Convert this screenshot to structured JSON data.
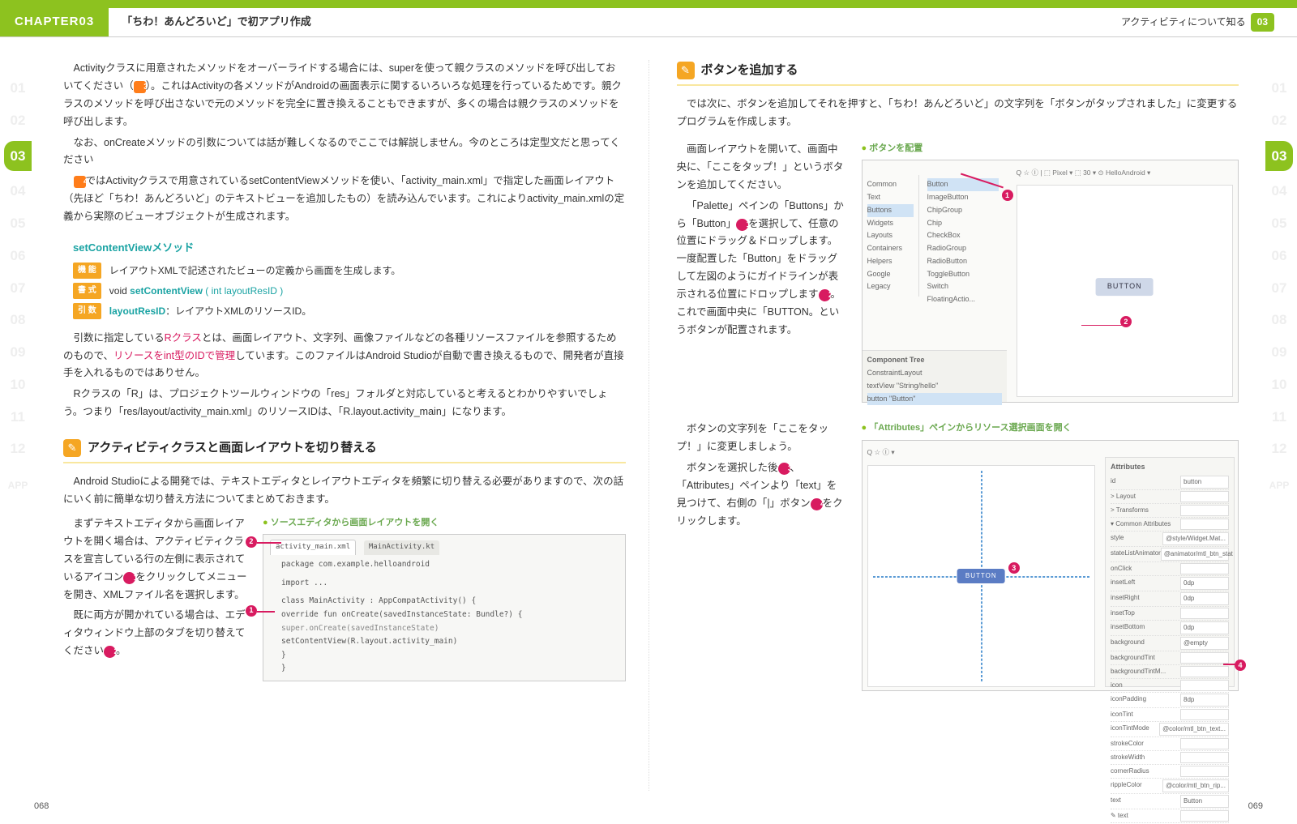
{
  "header": {
    "chapter": "CHAPTER03",
    "title": "「ちわ！あんどろいど」で初アプリ作成",
    "right_label": "アクティビティについて知る",
    "right_badge": "03"
  },
  "margins": {
    "nums": [
      "01",
      "02",
      "03",
      "04",
      "05",
      "06",
      "07",
      "08",
      "09",
      "10",
      "11",
      "12"
    ],
    "app": "APP",
    "active": "03"
  },
  "left": {
    "p1": "Activityクラスに用意されたメソッドをオーバーライドする場合には、superを使って親クラスのメソッドを呼び出しておいてください（",
    "p1b": "）。これはActivityの各メソッドがAndroidの画面表示に関するいろいろな処理を行っているためです。親クラスのメソッドを呼び出さないで元のメソッドを完全に置き換えることもできますが、多くの場合は親クラスのメソッドを呼び出します。",
    "p1badge": "3",
    "p2": "なお、onCreateメソッドの引数については話が難しくなるのでここでは解説しません。今のところは定型文だと思ってください",
    "p3a": "",
    "p3badge": "4",
    "p3b": "ではActivityクラスで用意されているsetContentViewメソッドを使い、「activity_main.xml」で指定した画面レイアウト（先ほど「ちわ！あんどろいど」のテキストビューを追加したもの）を読み込んでいます。これによりactivity_main.xmlの定義から実際のビューオブジェクトが生成されます。",
    "method": {
      "title": "setContentViewメソッド",
      "kinou_label": "機 能",
      "kinou": "レイアウトXMLで記述されたビューの定義から画面を生成します。",
      "shoshiki_label": "書 式",
      "shoshiki_pre": "void ",
      "shoshiki_name": "setContentView",
      "shoshiki_args": " ( int layoutResID )",
      "hikisu_label": "引 数",
      "hikisu_name": "layoutResID",
      "hikisu": "：レイアウトXMLのリソースID。"
    },
    "p4a": "引数に指定している",
    "p4r": "Rクラス",
    "p4b": "とは、画面レイアウト、文字列、画像ファイルなどの各種リソースファイルを参照するためのもので、",
    "p4r2": "リソースをint型のIDで管理",
    "p4c": "しています。このファイルはAndroid Studioが自動で書き換えるもので、開発者が直接手を入れるものではありせん。",
    "p5": "Rクラスの「R」は、プロジェクトツールウィンドウの「res」フォルダと対応していると考えるとわかりやすいでしょう。つまり「res/layout/activity_main.xml」のリソースIDは、「R.layout.activity_main」になります。",
    "section2": "アクティビティクラスと画面レイアウトを切り替える",
    "s2p1": "Android Studioによる開発では、テキストエディタとレイアウトエディタを頻繁に切り替える必要がありますので、次の話にいく前に簡単な切り替え方法についてまとめておきます。",
    "s2col1a": "まずテキストエディタから画面レイアウトを開く場合は、アクティビティクラスを宣言している行の左側に表示されているアイコン",
    "s2col1b": "をクリックしてメニューを開き、XMLファイル名を選択します。",
    "s2col2a": "既に両方が開かれている場合は、エディタウィンドウ上部のタブを切り替えてください",
    "s2col2b": "。",
    "fig1": {
      "cap": "ソースエディタから画面レイアウトを開く",
      "tab1": "activity_main.xml",
      "tab2": "MainActivity.kt",
      "l1": "package com.example.helloandroid",
      "l2": "import ...",
      "l3": "class MainActivity : AppCompatActivity() {",
      "l4": "    override fun onCreate(savedInstanceState: Bundle?) {",
      "l5": "        super.onCreate(savedInstanceState)",
      "l6": "        setContentView(R.layout.activity_main)",
      "l7": "    }",
      "l8": "}"
    }
  },
  "right": {
    "section": "ボタンを追加する",
    "p1": "では次に、ボタンを追加してそれを押すと、「ちわ！あんどろいど」の文字列を「ボタンがタップされました」に変更するプログラムを作成します。",
    "col1a": "画面レイアウトを開いて、画面中央に、「ここをタップ！」というボタンを追加してください。",
    "col1b": "「Palette」ペインの「Buttons」から「Button」",
    "col1c": "を選択して、任意の位置にドラッグ＆ドロップします。一度配置した「Button」をドラッグして左図のようにガイドラインが表示される位置にドロップします",
    "col1d": "。これで画面中央に「BUTTON。というボタンが配置されます。",
    "fig2": {
      "cap": "ボタンを配置",
      "palette_cats": [
        "Common",
        "Text",
        "Buttons",
        "Widgets",
        "Layouts",
        "Containers",
        "Helpers",
        "Google",
        "Legacy"
      ],
      "palette_items": [
        "Button",
        "ImageButton",
        "ChipGroup",
        "Chip",
        "CheckBox",
        "RadioGroup",
        "RadioButton",
        "ToggleButton",
        "Switch",
        "FloatingActio..."
      ],
      "tree_title": "Component Tree",
      "tree_items": [
        "ConstraintLayout",
        "  textView \"String/hello\"",
        "  button \"Button\""
      ],
      "toolbar": "Q ☆ Ⓘ | ⬚ Pixel ▾ ⬚ 30 ▾ ⊙ HelloAndroid ▾",
      "btn": "BUTTON"
    },
    "p2a": "ボタンの文字列を「ここをタップ！」に変更しましょう。",
    "p2b": "ボタンを選択した後",
    "p2c": "、「Attributes」ペインより「text」を見つけて、右側の「|」ボタン",
    "p2d": "をクリックします。",
    "fig3": {
      "cap": "「Attributes」ペインからリソース選択画面を開く",
      "attr_title": "Attributes",
      "toolbar": "Q ☆ Ⓘ    ▾",
      "rows": [
        [
          "id",
          "button"
        ],
        [
          "> Layout",
          ""
        ],
        [
          "> Transforms",
          ""
        ],
        [
          "▾ Common Attributes",
          ""
        ],
        [
          "style",
          "@style/Widget.Mat..."
        ],
        [
          "stateListAnimator",
          "@animator/mtl_btn_stat"
        ],
        [
          "onClick",
          ""
        ],
        [
          "insetLeft",
          "0dp"
        ],
        [
          "insetRight",
          "0dp"
        ],
        [
          "insetTop",
          ""
        ],
        [
          "insetBottom",
          "0dp"
        ],
        [
          "background",
          "@empty"
        ],
        [
          "backgroundTint",
          ""
        ],
        [
          "backgroundTintM...",
          ""
        ],
        [
          "icon",
          ""
        ],
        [
          "iconPadding",
          "8dp"
        ],
        [
          "iconTint",
          ""
        ],
        [
          "iconTintMode",
          "@color/mtl_btn_text..."
        ],
        [
          "strokeColor",
          ""
        ],
        [
          "strokeWidth",
          ""
        ],
        [
          "cornerRadius",
          ""
        ],
        [
          "rippleColor",
          "@color/mtl_btn_rip..."
        ],
        [
          "text",
          "Button"
        ],
        [
          "✎ text",
          ""
        ]
      ],
      "btn": "BUTTON"
    }
  },
  "pagenum": {
    "left": "068",
    "right": "069"
  }
}
